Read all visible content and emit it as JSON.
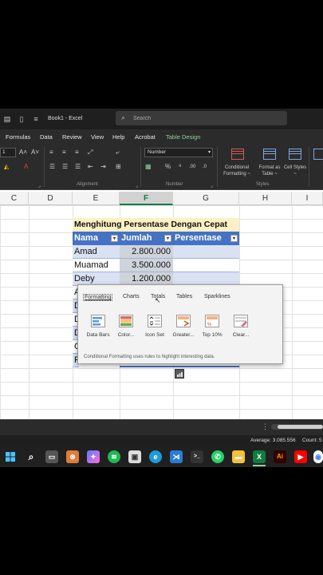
{
  "titlebar": {
    "book_title": "Book1  -  Excel",
    "search_placeholder": "Search"
  },
  "menu": [
    "Formulas",
    "Data",
    "Review",
    "View",
    "Help",
    "Acrobat",
    "Table Design"
  ],
  "ribbon": {
    "font_size": "1",
    "number_format": "Number",
    "groups": {
      "alignment": "Alignment",
      "number": "Number",
      "styles": "Styles"
    },
    "conditional_formatting": "Conditional Formatting ~",
    "format_as_table": "Format as Table ~",
    "cell_styles": "Cell Styles ~"
  },
  "columns": [
    "C",
    "D",
    "E",
    "F",
    "G",
    "H",
    "I"
  ],
  "selected_column": "F",
  "table": {
    "title": "Menghitung Persentase Dengan Cepat",
    "headers": [
      "Nama",
      "Jumlah",
      "Persentase"
    ],
    "rows": [
      {
        "nama": "Amad",
        "jumlah": "2.800.000"
      },
      {
        "nama": "Muamad",
        "jumlah": "3.500.000"
      },
      {
        "nama": "Deby",
        "jumlah": "1.200.000"
      }
    ],
    "partial_row_letters": [
      "A",
      "D",
      "D",
      "D",
      "C",
      "F"
    ]
  },
  "quick_analysis": {
    "tabs": [
      "Formatting",
      "Charts",
      "Totals",
      "Tables",
      "Sparklines"
    ],
    "active_tab": "Formatting",
    "options": [
      "Data Bars",
      "Color...",
      "Icon Set",
      "Greater...",
      "Top 10%",
      "Clear..."
    ],
    "description": "Conditional Formatting uses rules to highlight interesting data."
  },
  "status": {
    "average": "Average: 3.085.556",
    "count": "Count: 5"
  },
  "colors": {
    "accent": "#107c41",
    "table_header": "#4472c4",
    "band": "#d9e1f2",
    "title_fill": "#fdf0c4"
  }
}
